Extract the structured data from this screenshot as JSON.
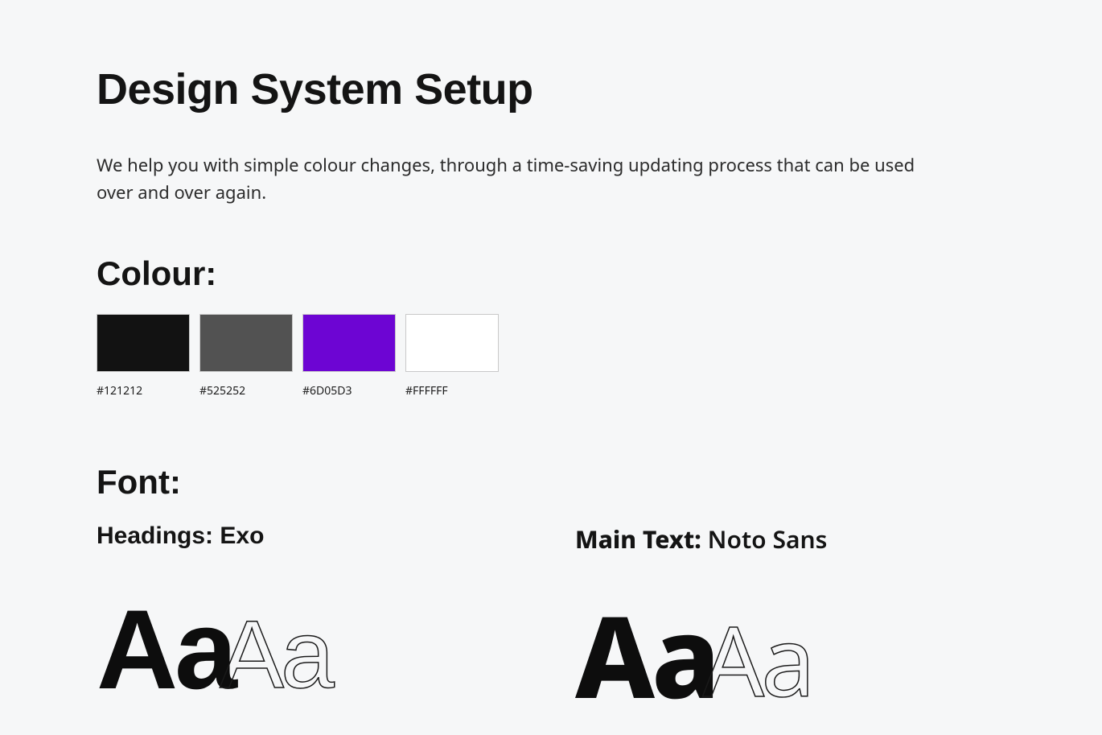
{
  "page": {
    "title": "Design System Setup",
    "intro": "We help you with simple colour changes, through a time-saving updating process that can be used over and over again."
  },
  "colour": {
    "heading": "Colour:",
    "swatches": [
      {
        "hex": "#121212",
        "label": "#121212"
      },
      {
        "hex": "#525252",
        "label": "#525252"
      },
      {
        "hex": "#6D05D3",
        "label": "#6D05D3"
      },
      {
        "hex": "#FFFFFF",
        "label": "#FFFFFF"
      }
    ]
  },
  "font": {
    "heading": "Font:",
    "headings_label": "Headings:",
    "headings_name": "Exo",
    "main_label": "Main Text:",
    "main_name": "Noto Sans",
    "sample_solid": "Aa",
    "sample_outline": "Aa"
  }
}
